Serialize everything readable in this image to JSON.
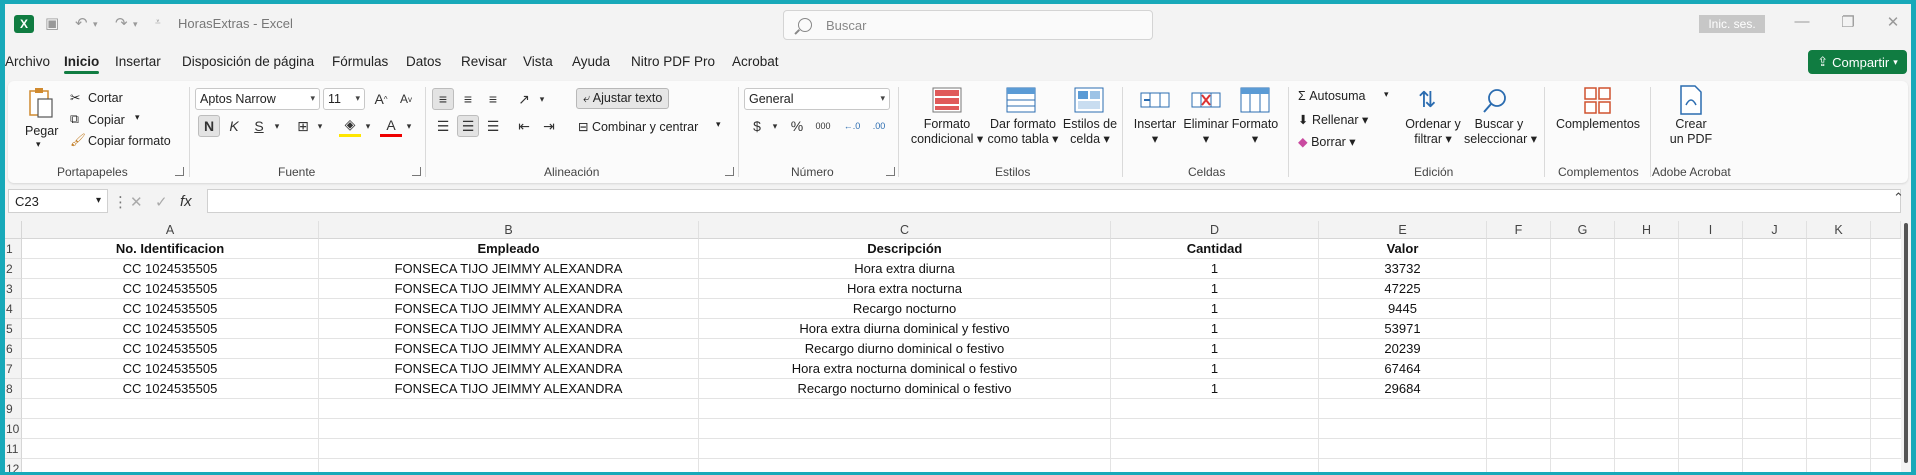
{
  "titlebar": {
    "app_icon": "excel-icon",
    "title": "HorasExtras  -  Excel",
    "search_placeholder": "Buscar",
    "signin": "Inic. ses."
  },
  "menu": {
    "tabs": [
      "Archivo",
      "Inicio",
      "Insertar",
      "Disposición de página",
      "Fórmulas",
      "Datos",
      "Revisar",
      "Vista",
      "Ayuda",
      "Nitro PDF Pro",
      "Acrobat"
    ],
    "active": "Inicio",
    "share": "Compartir"
  },
  "ribbon": {
    "clipboard": {
      "paste": "Pegar",
      "cut": "Cortar",
      "copy": "Copiar",
      "format_painter": "Copiar formato",
      "label": "Portapapeles"
    },
    "font": {
      "name": "Aptos Narrow",
      "size": "11",
      "label": "Fuente",
      "bold": "N",
      "italic": "K",
      "underline": "S"
    },
    "alignment": {
      "wrap": "Ajustar texto",
      "merge": "Combinar y centrar",
      "label": "Alineación"
    },
    "number": {
      "format": "General",
      "label": "Número"
    },
    "styles": {
      "conditional": [
        "Formato",
        "condicional"
      ],
      "table": [
        "Dar formato",
        "como tabla"
      ],
      "cell": [
        "Estilos de",
        "celda"
      ],
      "label": "Estilos"
    },
    "cells": {
      "insert": "Insertar",
      "delete": "Eliminar",
      "format": "Formato",
      "label": "Celdas"
    },
    "editing": {
      "autosum": "Autosuma",
      "fill": "Rellenar",
      "clear": "Borrar",
      "sort": [
        "Ordenar y",
        "filtrar"
      ],
      "find": [
        "Buscar y",
        "seleccionar"
      ],
      "label": "Edición"
    },
    "addins": {
      "button": "Complementos",
      "label": "Complementos"
    },
    "acrobat": {
      "button": [
        "Crear",
        "un PDF"
      ],
      "label": "Adobe Acrobat"
    }
  },
  "formula_bar": {
    "name_box": "C23",
    "fx": "fx",
    "value": ""
  },
  "sheet": {
    "columns": [
      "A",
      "B",
      "C",
      "D",
      "E",
      "F",
      "G",
      "H",
      "I",
      "J",
      "K"
    ],
    "row_numbers": [
      "1",
      "2",
      "3",
      "4",
      "5",
      "6",
      "7",
      "8",
      "9",
      "10",
      "11",
      "12"
    ],
    "header": [
      "No. Identificacion",
      "Empleado",
      "Descripción",
      "Cantidad",
      "Valor"
    ],
    "rows": [
      [
        "CC 1024535505",
        "FONSECA  TIJO JEIMMY  ALEXANDRA",
        "Hora extra diurna",
        "1",
        "33732"
      ],
      [
        "CC 1024535505",
        "FONSECA  TIJO JEIMMY  ALEXANDRA",
        "Hora extra nocturna",
        "1",
        "47225"
      ],
      [
        "CC 1024535505",
        "FONSECA  TIJO JEIMMY  ALEXANDRA",
        "Recargo nocturno",
        "1",
        "9445"
      ],
      [
        "CC 1024535505",
        "FONSECA  TIJO JEIMMY  ALEXANDRA",
        "Hora extra diurna dominical y festivo",
        "1",
        "53971"
      ],
      [
        "CC 1024535505",
        "FONSECA  TIJO JEIMMY  ALEXANDRA",
        "Recargo diurno dominical o festivo",
        "1",
        "20239"
      ],
      [
        "CC 1024535505",
        "FONSECA  TIJO JEIMMY  ALEXANDRA",
        "Hora extra nocturna dominical o festivo",
        "1",
        "67464"
      ],
      [
        "CC 1024535505",
        "FONSECA  TIJO JEIMMY  ALEXANDRA",
        "Recargo nocturno dominical o festivo",
        "1",
        "29684"
      ]
    ]
  },
  "colors": {
    "accent": "#107c41",
    "frame": "#18a9b9"
  }
}
